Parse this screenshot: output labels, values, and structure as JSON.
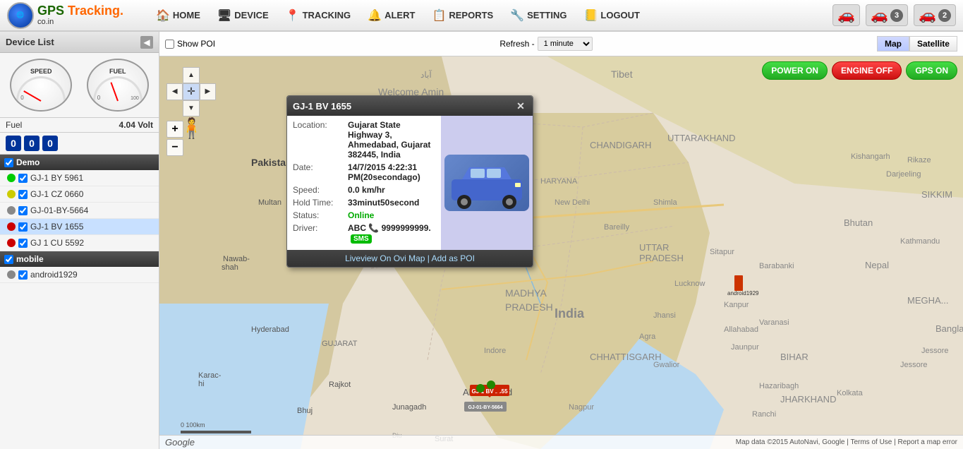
{
  "logo": {
    "globe_text": "GPS",
    "name": "GPS",
    "name_highlight": "Tracking.",
    "sub": "co.in"
  },
  "nav": {
    "items": [
      {
        "label": "HOME",
        "icon": "🏠"
      },
      {
        "label": "DEVICE",
        "icon": "🖥"
      },
      {
        "label": "TRACKING",
        "icon": "📍"
      },
      {
        "label": "ALERT",
        "icon": "🔔"
      },
      {
        "label": "REPORTS",
        "icon": "📋"
      },
      {
        "label": "SETTING",
        "icon": "🔧"
      },
      {
        "label": "LOGOUT",
        "icon": "📒"
      }
    ]
  },
  "header_right": {
    "cars": [
      {
        "color": "#228800",
        "count": ""
      },
      {
        "color": "#cc2200",
        "count": "3"
      },
      {
        "color": "#444444",
        "count": "2"
      }
    ]
  },
  "sidebar": {
    "title": "Device List",
    "collapse_label": "◀",
    "fuel_label": "Fuel",
    "fuel_value": "4.04 Volt",
    "odometer": [
      "0",
      "0",
      "0"
    ],
    "groups": [
      {
        "name": "Demo",
        "devices": [
          {
            "name": "GJ-1 BY 5961",
            "status": "green"
          },
          {
            "name": "GJ-1 CZ 0660",
            "status": "yellow"
          },
          {
            "name": "GJ-01-BY-5664",
            "status": "gray"
          },
          {
            "name": "GJ-1 BV 1655",
            "status": "red"
          },
          {
            "name": "GJ 1 CU 5592",
            "status": "red"
          }
        ]
      },
      {
        "name": "mobile",
        "devices": [
          {
            "name": "android1929",
            "status": "gray"
          }
        ]
      }
    ]
  },
  "map": {
    "show_poi_label": "Show POI",
    "refresh_label": "Refresh -",
    "refresh_option": "1 minute",
    "map_btn": "Map",
    "satellite_btn": "Satellite",
    "power_on_label": "POWER ON",
    "engine_off_label": "ENGINE OFF",
    "gps_on_label": "GPS ON",
    "footer": "Map data ©2015 AutoNavi, Google  |  Terms of Use  |  Report a map error",
    "google_label": "Google"
  },
  "popup": {
    "title": "GJ-1 BV 1655",
    "location_label": "Location:",
    "location_value": "Gujarat State Highway 3, Ahmedabad, Gujarat 382445, India",
    "date_label": "Date:",
    "date_value": "14/7/2015 4:22:31 PM(20secondago)",
    "speed_label": "Speed:",
    "speed_value": "0.0 km/hr",
    "hold_label": "Hold Time:",
    "hold_value": "33minut50second",
    "status_label": "Status:",
    "status_value": "Online",
    "driver_label": "Driver:",
    "driver_name": "ABC",
    "driver_phone": "9999999999.",
    "footer_text": "Liveview On Ovi Map  |  Add as POI",
    "close": "✕"
  }
}
